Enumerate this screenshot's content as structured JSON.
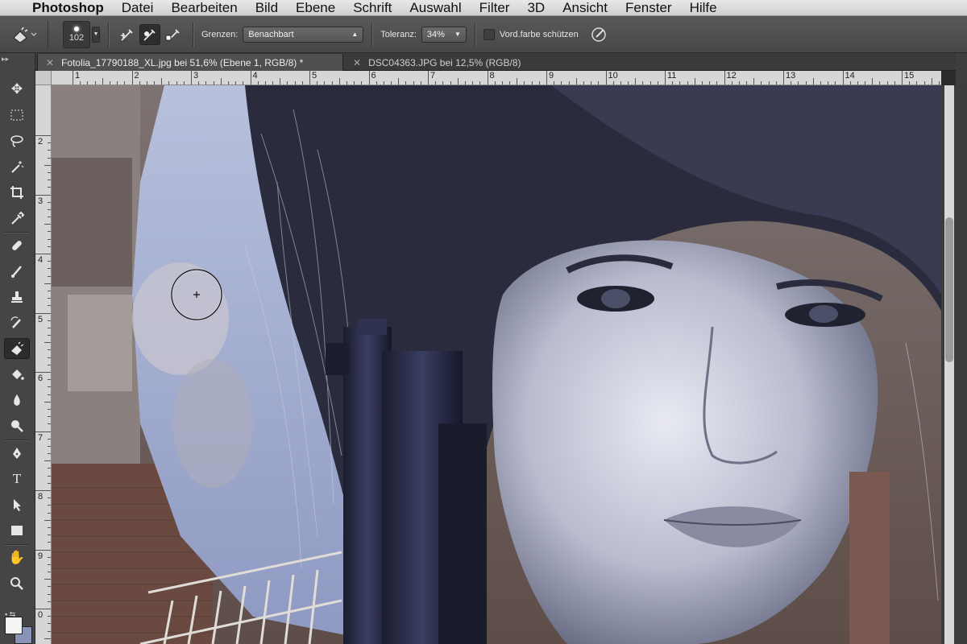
{
  "menubar": {
    "app_name": "Photoshop",
    "items": [
      "Datei",
      "Bearbeiten",
      "Bild",
      "Ebene",
      "Schrift",
      "Auswahl",
      "Filter",
      "3D",
      "Ansicht",
      "Fenster",
      "Hilfe"
    ]
  },
  "options": {
    "brush_size": "102",
    "grenzen_label": "Grenzen:",
    "grenzen_value": "Benachbart",
    "toleranz_label": "Toleranz:",
    "toleranz_value": "34%",
    "protect_fg_label": "Vord.farbe schützen"
  },
  "tabs": [
    {
      "title": "Fotolia_17790188_XL.jpg bei 51,6% (Ebene 1, RGB/8) *",
      "active": true
    },
    {
      "title": "DSC04363.JPG bei 12,5% (RGB/8)",
      "active": false
    }
  ],
  "rulers": {
    "horizontal": [
      "1",
      "2",
      "3",
      "4",
      "5",
      "6",
      "7",
      "8",
      "9",
      "10",
      "11",
      "12",
      "13",
      "14",
      "15"
    ],
    "vertical": [
      "2",
      "3",
      "4",
      "5",
      "6",
      "7",
      "8",
      "9",
      "0"
    ]
  },
  "colors": {
    "foreground": "#f4f4f4",
    "background": "#8a93b8"
  },
  "tools": [
    "move-icon",
    "marquee-icon",
    "lasso-icon",
    "magic-wand-icon",
    "crop-icon",
    "eyedropper-icon",
    "healing-icon",
    "brush-icon",
    "stamp-icon",
    "history-brush-icon",
    "background-eraser-icon",
    "paint-bucket-icon",
    "blur-icon",
    "dodge-icon",
    "pen-icon",
    "type-icon",
    "path-select-icon",
    "rectangle-icon",
    "hand-icon",
    "zoom-icon"
  ]
}
